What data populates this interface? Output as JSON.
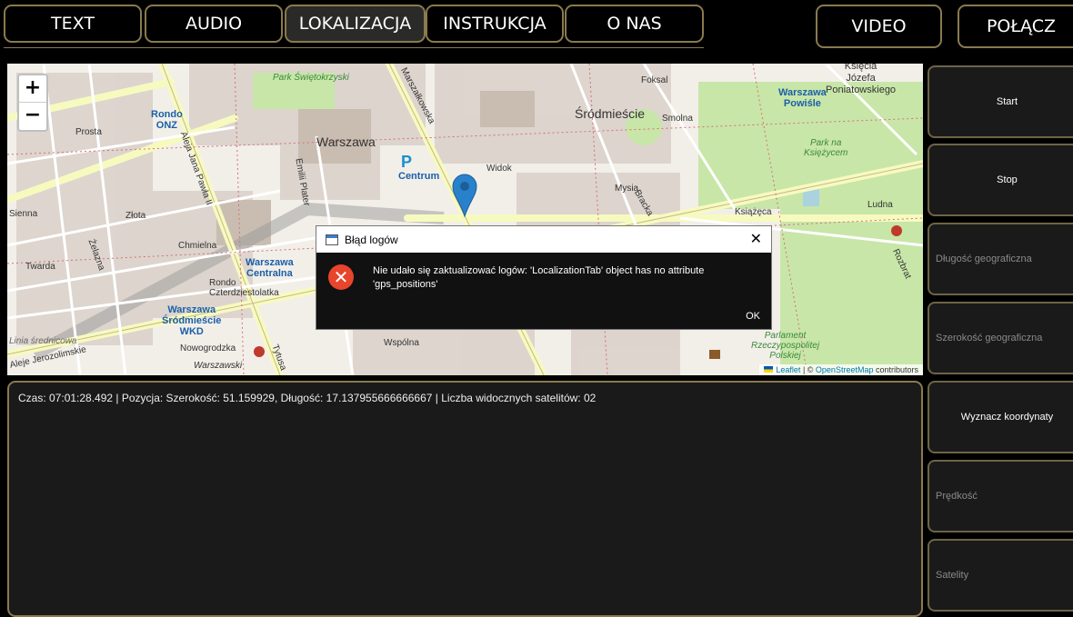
{
  "tabs": [
    "TEXT",
    "AUDIO",
    "LOKALIZACJA",
    "INSTRUKCJA",
    "O NAS"
  ],
  "top_buttons": {
    "video": "VIDEO",
    "connect": "POŁĄCZ"
  },
  "map": {
    "zoom_in": "+",
    "zoom_out": "−",
    "labels": {
      "warszawa": "Warszawa",
      "srodmiescie": "Śródmieście",
      "rondo_onz": "Rondo\nONZ",
      "park_swietokrzyski": "Park Świętokrzyski",
      "centrum": "Centrum",
      "warszawa_centralna": "Warszawa\nCentralna",
      "warszawa_srodmiescie_wkd": "Warszawa\nŚródmieście\nWKD",
      "warszawa_powisle": "Warszawa\nPowiśle",
      "ksiecia_jozefa": "Księcia\nJózefa\nPoniatowskiego",
      "park_na_ksiezycem": "Park na\nKsiężycem",
      "parkament": "Parlament\nRzeczypospolitej\nPolskiej",
      "marszalkowska": "Marszałkowska",
      "aleja_jana_pawla": "Aleja Jana Pawła II",
      "emilii_plater": "Emilii Plater",
      "prosta": "Prosta",
      "sienna": "Sienna",
      "zlota": "Złota",
      "chmielna": "Chmielna",
      "zelazna": "Żelazna",
      "twarda": "Twarda",
      "widok": "Widok",
      "ksiazeca": "Książęca",
      "smolna": "Smolna",
      "foksal": "Foksal",
      "ludna": "Ludna",
      "rozbrat": "Rozbrat",
      "wspolna": "Wspólna",
      "nowogrodzka": "Nowogrodzka",
      "aleje_jerozolimskie": "Aleje Jerozolimskie",
      "warszawski": "Warszawski",
      "tytusa": "Tytusa",
      "rondo_czterdziestolatka": "Rondo\nCzterdziestolatka",
      "mysia": "Mysia",
      "bracka": "Bracka",
      "p": "P",
      "linia_srednicowa": "Linia średnicowa"
    },
    "attribution": {
      "leaflet": "Leaflet",
      "sep": " | © ",
      "osm": "OpenStreetMap",
      "contributors": " contributors"
    },
    "colors": {
      "marker": "#2a81cb",
      "park": "#c8e6a8",
      "building": "#d9d0c9",
      "road_major": "#f7fabf"
    }
  },
  "log": {
    "line": "Czas: 07:01:28.492 | Pozycja: Szerokość: 51.159929, Długość: 17.137955666666667 | Liczba widocznych satelitów: 02"
  },
  "side": {
    "start": "Start",
    "stop": "Stop",
    "longitude": "Długość geograficzna",
    "latitude": "Szerokość geograficzna",
    "compute": "Wyznacz koordynaty",
    "speed": "Prędkość",
    "satellites": "Satelity"
  },
  "dialog": {
    "title": "Błąd logów",
    "message": "Nie udało się zaktualizować logów: 'LocalizationTab' object has no attribute 'gps_positions'",
    "ok": "OK",
    "close": "✕",
    "error_glyph": "✕"
  }
}
